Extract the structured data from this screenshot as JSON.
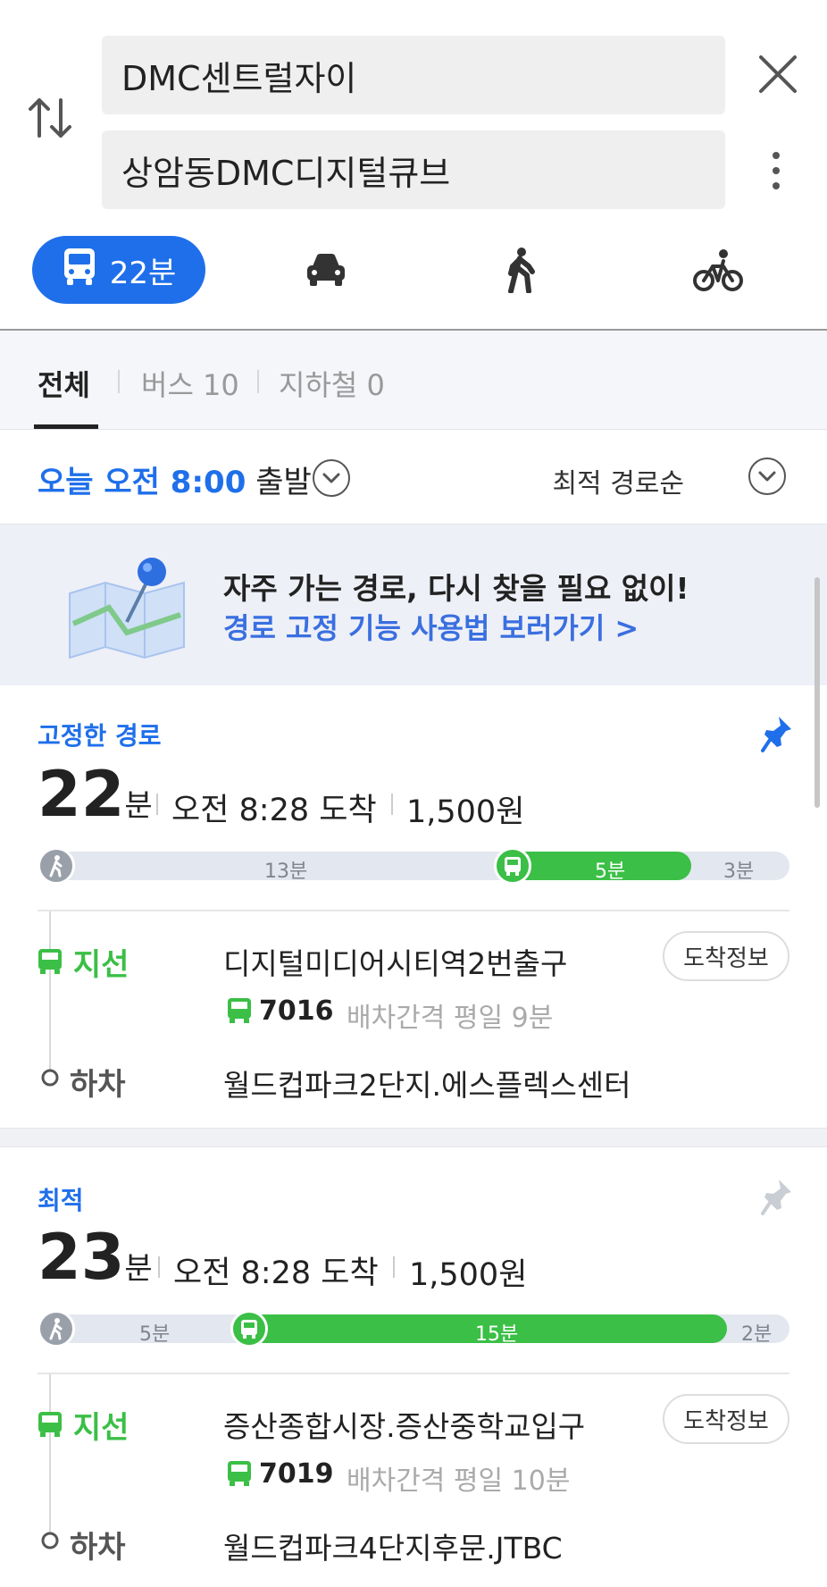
{
  "header": {
    "origin": "DMC센트럴자이",
    "destination": "상암동DMC디지털큐브"
  },
  "modes": {
    "active_label": "22분"
  },
  "tabs": [
    {
      "label": "전체"
    },
    {
      "label": "버스 10"
    },
    {
      "label": "지하철 0"
    }
  ],
  "departure": {
    "time_label": "오늘 오전 8:00",
    "suffix": "출발",
    "sort_label": "최적 경로순"
  },
  "banner": {
    "title": "자주 가는 경로, 다시 찾을 필요 없이!",
    "link": "경로 고정 기능 사용법 보러가기 >"
  },
  "routes": [
    {
      "tag": "고정한 경로",
      "minutes": "22",
      "min_unit": "분",
      "arrival": "오전 8:28 도착",
      "fare": "1,500원",
      "segments": {
        "walk1": "13분",
        "bus": "5분",
        "walk2": "3분"
      },
      "bus_type": "지선",
      "board_stop": "디지털미디어시티역2번출구",
      "arrive_button": "도착정보",
      "bus_number": "7016",
      "interval": "배차간격 평일 9분",
      "alight_label": "하차",
      "alight_stop": "월드컵파크2단지.에스플렉스센터"
    },
    {
      "tag": "최적",
      "minutes": "23",
      "min_unit": "분",
      "arrival": "오전 8:28 도착",
      "fare": "1,500원",
      "segments": {
        "walk1": "5분",
        "bus": "15분",
        "walk2": "2분"
      },
      "bus_type": "지선",
      "board_stop": "증산종합시장.증산중학교입구",
      "arrive_button": "도착정보",
      "bus_number": "7019",
      "interval": "배차간격 평일 10분",
      "alight_label": "하차",
      "alight_stop": "월드컵파크4단지후문.JTBC"
    }
  ],
  "colors": {
    "accent_blue": "#1f6fea",
    "bus_green": "#3bbf46",
    "link_blue": "#3a6fe0"
  }
}
